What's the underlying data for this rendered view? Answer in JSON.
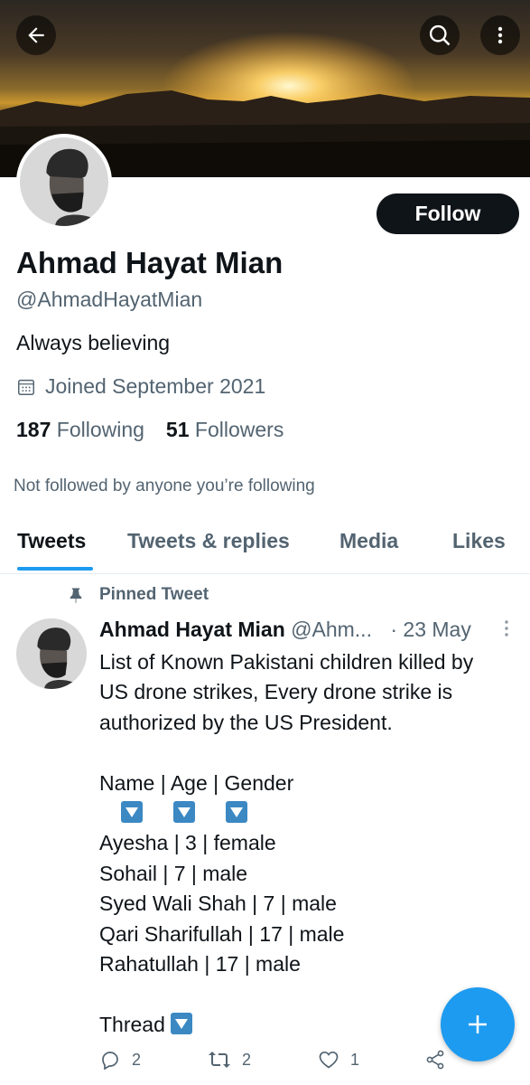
{
  "profile": {
    "name": "Ahmad Hayat Mian",
    "handle": "@AhmadHayatMian",
    "bio": "Always believing",
    "joined": "Joined September 2021",
    "following_count": "187",
    "following_label": "Following",
    "followers_count": "51",
    "followers_label": "Followers",
    "not_followed_text": "Not followed by anyone you’re following",
    "follow_label": "Follow"
  },
  "header": {
    "back_icon": "back-arrow-icon",
    "search_icon": "search-icon",
    "more_icon": "more-vertical-icon"
  },
  "tabs": [
    {
      "label": "Tweets",
      "active": true
    },
    {
      "label": "Tweets & replies",
      "active": false
    },
    {
      "label": "Media",
      "active": false
    },
    {
      "label": "Likes",
      "active": false
    }
  ],
  "tweet": {
    "pinned_label": "Pinned Tweet",
    "author_name": "Ahmad Hayat Mian",
    "author_handle": "@Ahm...",
    "date": "· 23 May",
    "lines": [
      "List of Known Pakistani children killed by",
      "US drone strikes, Every drone strike is",
      "authorized by the US President.",
      "",
      "Name | Age | Gender",
      "",
      "Ayesha | 3 | female",
      "Sohail | 7 | male",
      "Syed Wali Shah | 7 | male",
      "Qari Sharifullah | 17 | male",
      "Rahatullah | 17 | male",
      "",
      "Thread"
    ],
    "reply_count": "2",
    "retweet_count": "2",
    "like_count": "1"
  },
  "colors": {
    "accent": "#1d9bf0",
    "text_primary": "#0f1419",
    "text_secondary": "#536471",
    "emoji_blue": "#3b88c3"
  }
}
